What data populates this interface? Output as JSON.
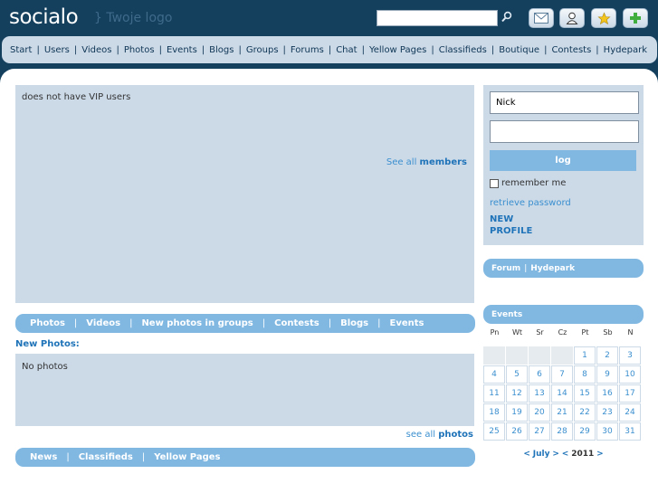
{
  "header": {
    "logo": "socialo",
    "logo_sub": "} Twoje logo",
    "search_placeholder": "",
    "icons": [
      "mail-icon",
      "user-icon",
      "star-icon",
      "plus-icon"
    ]
  },
  "nav": [
    "Start",
    "Users",
    "Videos",
    "Photos",
    "Events",
    "Blogs",
    "Groups",
    "Forums",
    "Chat",
    "Yellow Pages",
    "Classifieds",
    "Boutique",
    "Contests",
    "Hydepark"
  ],
  "vip": {
    "text": "does not have VIP users",
    "see_all_prefix": "See all",
    "see_all_link": "members"
  },
  "media_tabs": [
    "Photos",
    "Videos",
    "New photos in groups",
    "Contests",
    "Blogs",
    "Events"
  ],
  "new_photos": {
    "heading": "New Photos:",
    "empty_text": "No photos",
    "see_all_prefix": "see all",
    "see_all_link": "photos"
  },
  "bottom_tabs": [
    "News",
    "Classifieds",
    "Yellow Pages"
  ],
  "login": {
    "username_value": "Nick",
    "password_value": "",
    "log_button": "log",
    "remember_label": "remember me",
    "retrieve_link": "retrieve password",
    "new_profile_line1": "NEW",
    "new_profile_line2": "PROFILE"
  },
  "forum_bar": {
    "forum": "Forum",
    "sep": "|",
    "hydepark": "Hydepark"
  },
  "events": {
    "title": "Events",
    "weekdays": [
      "Pn",
      "Wt",
      "Sr",
      "Cz",
      "Pt",
      "Sb",
      "N"
    ],
    "weeks": [
      [
        "",
        "",
        "",
        "",
        "1",
        "2",
        "3"
      ],
      [
        "4",
        "5",
        "6",
        "7",
        "8",
        "9",
        "10"
      ],
      [
        "11",
        "12",
        "13",
        "14",
        "15",
        "16",
        "17"
      ],
      [
        "18",
        "19",
        "20",
        "21",
        "22",
        "23",
        "24"
      ],
      [
        "25",
        "26",
        "27",
        "28",
        "29",
        "30",
        "31"
      ]
    ],
    "month_prev": "<",
    "month": "July",
    "month_next": ">",
    "year_prev": "<",
    "year": "2011",
    "year_next": ">"
  },
  "colors": {
    "header_bg": "#14405e",
    "nav_bg": "#ccdae8",
    "accent_blue": "#80b8e2",
    "link_blue": "#3b8fcf"
  }
}
